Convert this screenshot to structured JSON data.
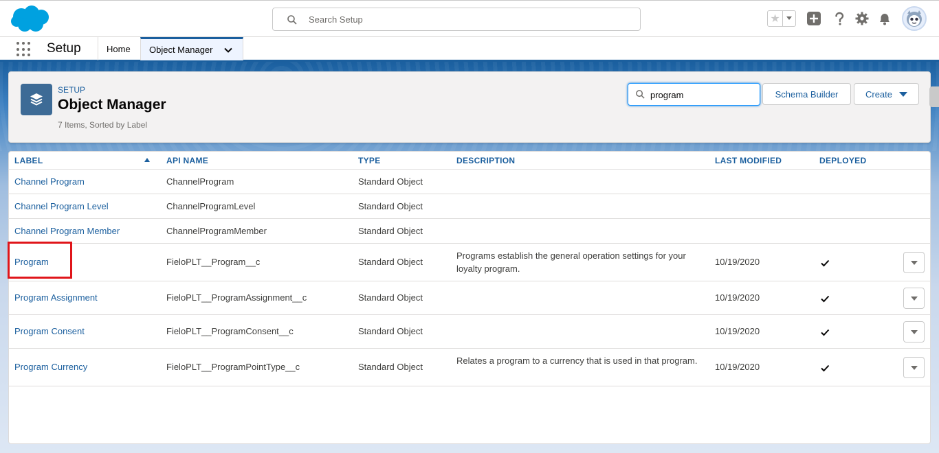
{
  "header": {
    "search_placeholder": "Search Setup",
    "icons": [
      "favorites-star-icon",
      "add-icon",
      "help-icon",
      "settings-gear-icon",
      "notifications-bell-icon",
      "avatar"
    ]
  },
  "context_bar": {
    "app_name": "Setup",
    "tabs": [
      {
        "label": "Home"
      },
      {
        "label": "Object Manager",
        "active": true
      }
    ]
  },
  "page_header": {
    "breadcrumb": "SETUP",
    "title": "Object Manager",
    "meta": "7 Items, Sorted by Label",
    "search_value": "program",
    "schema_builder_label": "Schema Builder",
    "create_label": "Create"
  },
  "table": {
    "columns": [
      "LABEL",
      "API NAME",
      "TYPE",
      "DESCRIPTION",
      "LAST MODIFIED",
      "DEPLOYED"
    ],
    "rows": [
      {
        "label": "Channel Program",
        "api_name": "ChannelProgram",
        "type": "Standard Object",
        "description": "",
        "last_modified": "",
        "deployed": false
      },
      {
        "label": "Channel Program Level",
        "api_name": "ChannelProgramLevel",
        "type": "Standard Object",
        "description": "",
        "last_modified": "",
        "deployed": false
      },
      {
        "label": "Channel Program Member",
        "api_name": "ChannelProgramMember",
        "type": "Standard Object",
        "description": "",
        "last_modified": "",
        "deployed": false
      },
      {
        "label": "Program",
        "api_name": "FieloPLT__Program__c",
        "type": "Standard Object",
        "description": "Programs establish the general operation settings for your loyalty program.",
        "last_modified": "10/19/2020",
        "deployed": true
      },
      {
        "label": "Program Assignment",
        "api_name": "FieloPLT__ProgramAssignment__c",
        "type": "Standard Object",
        "description": "",
        "last_modified": "10/19/2020",
        "deployed": true
      },
      {
        "label": "Program Consent",
        "api_name": "FieloPLT__ProgramConsent__c",
        "type": "Standard Object",
        "description": "",
        "last_modified": "10/19/2020",
        "deployed": true
      },
      {
        "label": "Program Currency",
        "api_name": "FieloPLT__ProgramPointType__c",
        "type": "Standard Object",
        "description": "Relates a program to a currency that is used in that program.",
        "last_modified": "10/19/2020",
        "deployed": true
      }
    ]
  },
  "colors": {
    "brand": "#1b5f9e",
    "highlight": "#e0151a"
  }
}
